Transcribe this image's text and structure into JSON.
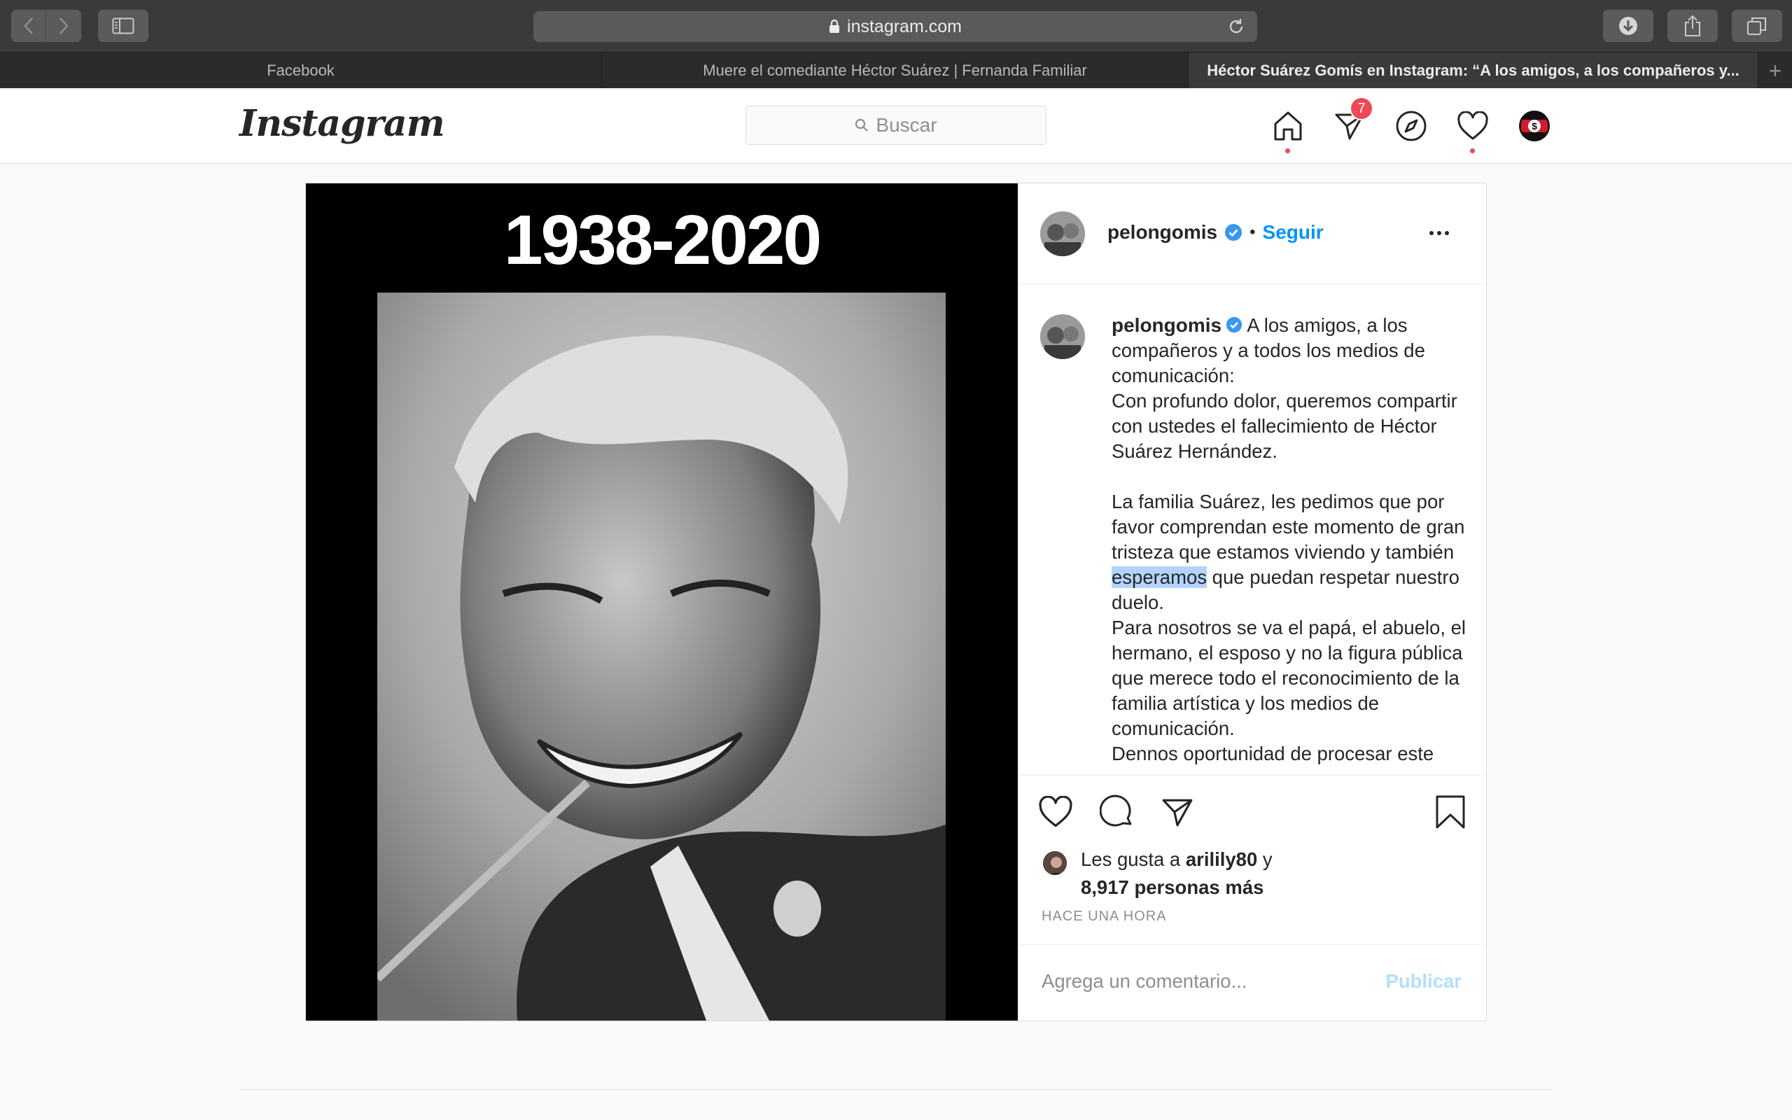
{
  "browser": {
    "url": "instagram.com",
    "tabs": [
      {
        "label": "Facebook",
        "active": false
      },
      {
        "label": "Muere el comediante Héctor Suárez | Fernanda Familiar",
        "active": false
      },
      {
        "label": "Héctor Suárez Gomís en Instagram: “A los amigos, a los compañeros y...",
        "active": true
      }
    ],
    "new_tab_label": "+"
  },
  "instagram": {
    "logo": "Instagram",
    "search_placeholder": "Buscar",
    "direct_badge": "7",
    "nav_icons": [
      "home-icon",
      "direct-icon",
      "explore-icon",
      "activity-icon",
      "profile-avatar"
    ]
  },
  "post": {
    "image_title": "1938-2020",
    "username": "pelongomis",
    "separator": "•",
    "follow_label": "Seguir",
    "caption_before": " A los amigos, a los compañeros y a todos los medios de comunicación:\nCon profundo dolor, queremos compartir con ustedes el fallecimiento de Héctor Suárez Hernández.\n\nLa familia Suárez, les pedimos que por favor comprendan este momento de gran tristeza que estamos viviendo y también ",
    "caption_highlight": "esperamos",
    "caption_after": " que puedan respetar nuestro duelo.\nPara nosotros se va el papá, el abuelo, el hermano, el esposo y no la figura pública que merece todo el reconocimiento de la familia artística y los medios de comunicación.\nDennos oportunidad de procesar este",
    "likes_prefix": "Les gusta a ",
    "likes_user": "arilily80",
    "likes_connector": " y",
    "likes_count": "8,917 personas más",
    "timestamp": "HACE UNA HORA",
    "comment_placeholder": "Agrega un comentario...",
    "publish_label": "Publicar"
  },
  "colors": {
    "accent": "#0095f6",
    "notification": "#ed4956",
    "publish_disabled": "#b2dffc",
    "highlight": "#b3d4fc"
  }
}
